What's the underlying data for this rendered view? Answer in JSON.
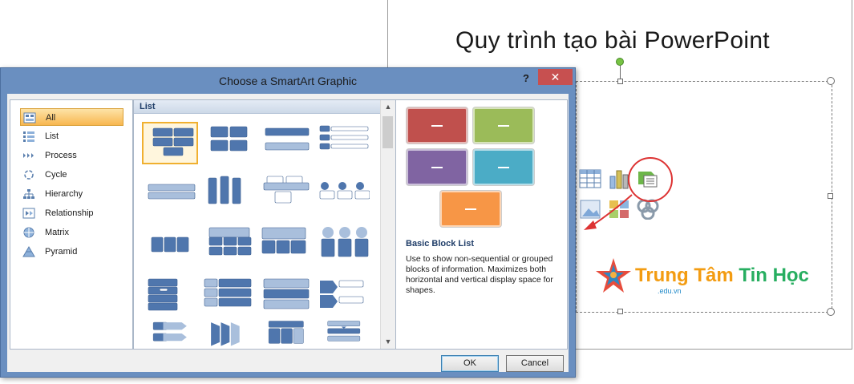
{
  "slide": {
    "title": "Quy trình tạo bài PowerPoint",
    "logo": {
      "text_part1": "Trung Tâm",
      "text_part2": "Tin Học",
      "subtext": ".edu.vn"
    }
  },
  "dialog": {
    "title": "Choose a SmartArt Graphic",
    "help_label": "?",
    "close_label": "✕",
    "categories": [
      {
        "label": "All",
        "icon": "all-icon",
        "selected": true
      },
      {
        "label": "List",
        "icon": "list-icon"
      },
      {
        "label": "Process",
        "icon": "process-icon"
      },
      {
        "label": "Cycle",
        "icon": "cycle-icon"
      },
      {
        "label": "Hierarchy",
        "icon": "hierarchy-icon"
      },
      {
        "label": "Relationship",
        "icon": "relationship-icon"
      },
      {
        "label": "Matrix",
        "icon": "matrix-icon"
      },
      {
        "label": "Pyramid",
        "icon": "pyramid-icon"
      }
    ],
    "gallery": {
      "header": "List"
    },
    "preview": {
      "title": "Basic Block List",
      "description": "Use to show non-sequential or grouped blocks of information. Maximizes both horizontal and vertical display space for shapes.",
      "colors": [
        "#c0504d",
        "#9bbb59",
        "#8064a2",
        "#4bacc6",
        "#f79646"
      ]
    },
    "ok_label": "OK",
    "cancel_label": "Cancel"
  },
  "colors": {
    "accent_blue": "#4f81bd",
    "title_bar": "#6a8fc0",
    "close_red": "#c75050",
    "selection_orange": "#f8b750"
  }
}
